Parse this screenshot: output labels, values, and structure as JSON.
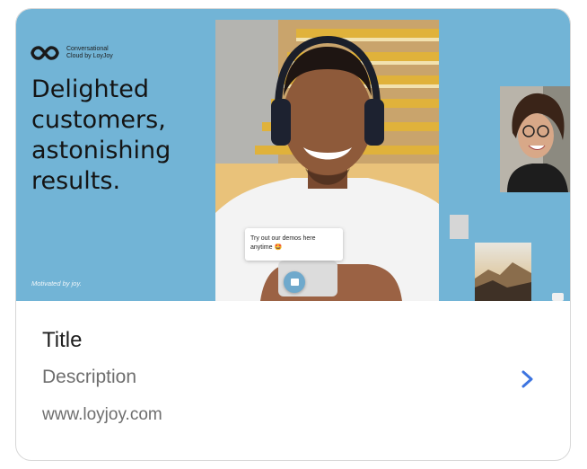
{
  "hero": {
    "brand_line1": "Conversational",
    "brand_line2": "Cloud by LoyJoy",
    "headline_1": "Delighted",
    "headline_2": "customers,",
    "headline_3": "astonishing",
    "headline_4": "results.",
    "tagline": "Motivated by joy.",
    "chat_text": "Try out our demos here anytime 🤩"
  },
  "card": {
    "title": "Title",
    "description": "Description",
    "url": "www.loyjoy.com"
  },
  "icons": {
    "logo": "infinity-logo-icon",
    "chat": "chat-bubble-icon",
    "chevron": "chevron-right-icon"
  },
  "colors": {
    "hero_bg": "#72b4d6",
    "chevron": "#3d74e0"
  }
}
